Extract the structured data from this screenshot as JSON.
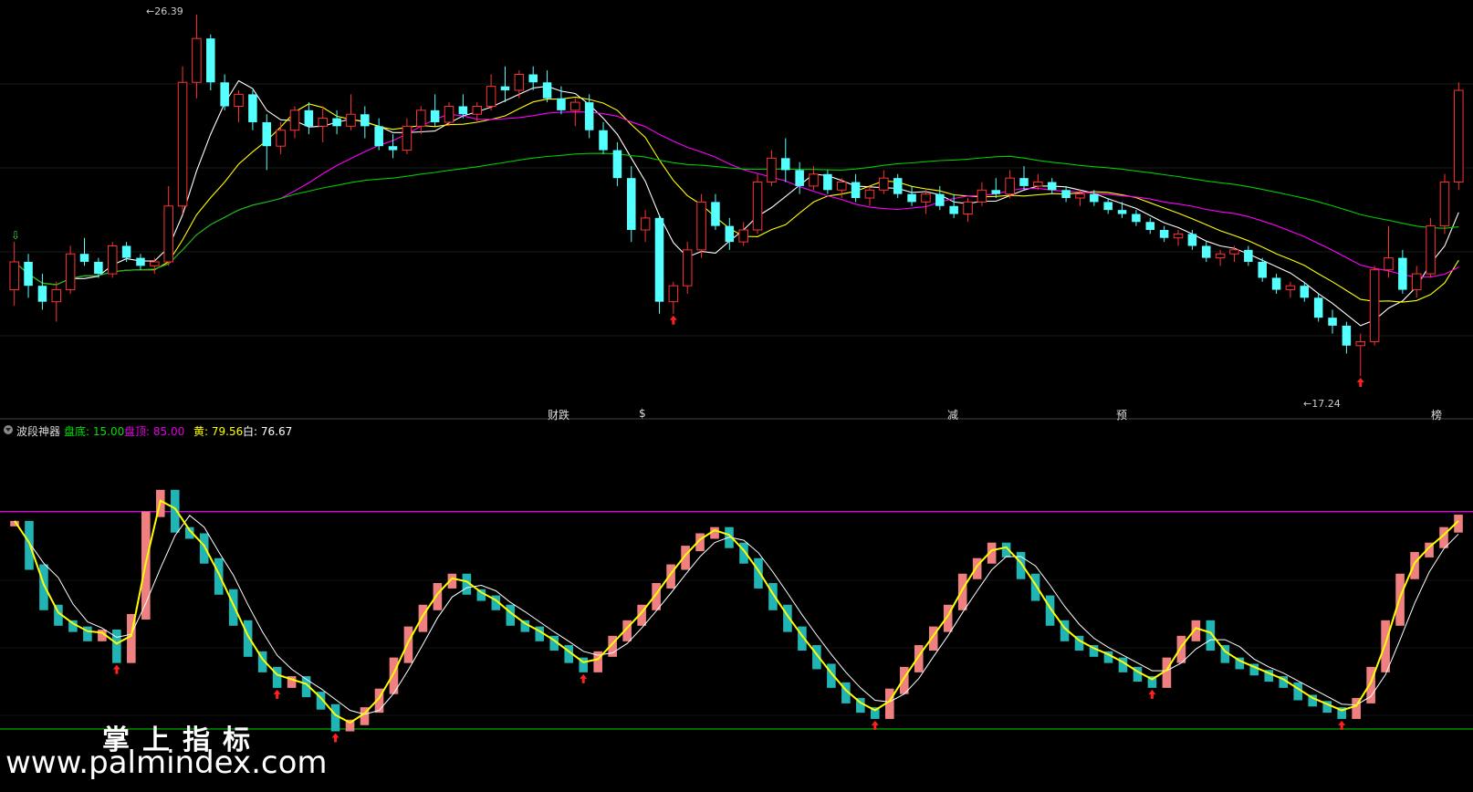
{
  "top_bar": {
    "left_text": "",
    "dots_color": "#c040c0"
  },
  "price_panel": {
    "high_label": "26.39",
    "low_label": "17.24",
    "buy_signal_top": "⇩",
    "signals": [
      {
        "text": "财跌",
        "color": "#9090ff"
      },
      {
        "text": "$",
        "color": "#ff3030"
      },
      {
        "text": "减",
        "color": "#40e040"
      },
      {
        "text": "预",
        "color": "#ff8040"
      },
      {
        "text": "榜",
        "color": "#ff8040"
      }
    ]
  },
  "indicator_panel": {
    "name": "波段神器",
    "items": [
      {
        "label": "盘底: 15.00",
        "color": "#00e000"
      },
      {
        "label": "盘顶: 85.00",
        "color": "#e000e0"
      },
      {
        "label": "黄: 79.56",
        "color": "#ffff00"
      },
      {
        "label": "白: 76.67",
        "color": "#ffffff"
      }
    ]
  },
  "watermark": {
    "line1": "掌上指标",
    "line2": "www.palmindex.com"
  },
  "colors": {
    "up": "#ff3232",
    "down": "#54ffff",
    "osc_up": "#f08080",
    "osc_down": "#20b4b4",
    "ma5": "#ffffff",
    "ma10": "#ffff00",
    "ma20": "#ff00ff",
    "ma60": "#00cc00"
  },
  "chart_data": {
    "type": "candlestick",
    "price_ylim": [
      17.24,
      26.39
    ],
    "candles": [
      [
        19.4,
        20.6,
        19.0,
        20.1
      ],
      [
        20.1,
        20.3,
        19.2,
        19.5
      ],
      [
        19.5,
        19.8,
        18.9,
        19.1
      ],
      [
        19.1,
        19.6,
        18.6,
        19.4
      ],
      [
        19.4,
        20.5,
        19.3,
        20.3
      ],
      [
        20.3,
        20.7,
        20.0,
        20.1
      ],
      [
        20.1,
        20.2,
        19.7,
        19.8
      ],
      [
        19.8,
        20.6,
        19.7,
        20.5
      ],
      [
        20.5,
        20.6,
        20.1,
        20.2
      ],
      [
        20.2,
        20.3,
        19.9,
        20.0
      ],
      [
        20.0,
        20.2,
        19.8,
        20.1
      ],
      [
        20.1,
        22.0,
        20.0,
        21.5
      ],
      [
        21.5,
        25.0,
        21.3,
        24.6
      ],
      [
        24.6,
        26.3,
        24.2,
        25.7
      ],
      [
        25.7,
        25.8,
        24.4,
        24.6
      ],
      [
        24.6,
        24.8,
        23.9,
        24.0
      ],
      [
        24.0,
        24.4,
        23.6,
        24.3
      ],
      [
        24.3,
        24.4,
        23.4,
        23.6
      ],
      [
        23.6,
        23.8,
        22.4,
        23.0
      ],
      [
        23.0,
        23.6,
        22.8,
        23.4
      ],
      [
        23.4,
        24.0,
        23.2,
        23.9
      ],
      [
        23.9,
        24.1,
        23.3,
        23.5
      ],
      [
        23.5,
        24.0,
        23.1,
        23.7
      ],
      [
        23.7,
        23.9,
        23.3,
        23.5
      ],
      [
        23.5,
        24.3,
        23.4,
        23.8
      ],
      [
        23.8,
        24.0,
        23.2,
        23.5
      ],
      [
        23.5,
        23.7,
        22.9,
        23.0
      ],
      [
        23.0,
        23.3,
        22.7,
        22.9
      ],
      [
        22.9,
        23.7,
        22.8,
        23.5
      ],
      [
        23.5,
        24.0,
        23.3,
        23.9
      ],
      [
        23.9,
        24.3,
        23.5,
        23.6
      ],
      [
        23.6,
        24.1,
        23.5,
        24.0
      ],
      [
        24.0,
        24.3,
        23.7,
        23.8
      ],
      [
        23.8,
        24.1,
        23.6,
        24.0
      ],
      [
        24.0,
        24.8,
        23.9,
        24.5
      ],
      [
        24.5,
        25.0,
        24.1,
        24.4
      ],
      [
        24.4,
        24.9,
        24.2,
        24.8
      ],
      [
        24.8,
        25.0,
        24.4,
        24.6
      ],
      [
        24.6,
        24.9,
        24.1,
        24.2
      ],
      [
        24.2,
        24.5,
        23.8,
        23.9
      ],
      [
        23.9,
        24.2,
        23.5,
        24.1
      ],
      [
        24.1,
        24.3,
        23.2,
        23.4
      ],
      [
        23.4,
        23.6,
        22.8,
        22.9
      ],
      [
        22.9,
        23.1,
        22.0,
        22.2
      ],
      [
        22.2,
        22.5,
        20.6,
        20.9
      ],
      [
        20.9,
        21.4,
        20.6,
        21.2
      ],
      [
        21.2,
        21.3,
        18.8,
        19.1
      ],
      [
        19.1,
        19.6,
        18.8,
        19.5
      ],
      [
        19.5,
        20.6,
        19.3,
        20.4
      ],
      [
        20.4,
        21.8,
        20.2,
        21.6
      ],
      [
        21.6,
        21.8,
        20.9,
        21.0
      ],
      [
        21.0,
        21.2,
        20.4,
        20.6
      ],
      [
        20.6,
        21.1,
        20.5,
        20.9
      ],
      [
        20.9,
        22.3,
        20.8,
        22.1
      ],
      [
        22.1,
        22.9,
        22.0,
        22.7
      ],
      [
        22.7,
        23.2,
        22.1,
        22.4
      ],
      [
        22.4,
        22.6,
        21.8,
        22.0
      ],
      [
        22.0,
        22.5,
        21.9,
        22.3
      ],
      [
        22.3,
        22.4,
        21.8,
        21.9
      ],
      [
        21.9,
        22.2,
        21.7,
        22.1
      ],
      [
        22.1,
        22.3,
        21.6,
        21.7
      ],
      [
        21.7,
        22.0,
        21.5,
        21.9
      ],
      [
        21.9,
        22.4,
        21.8,
        22.2
      ],
      [
        22.2,
        22.3,
        21.7,
        21.8
      ],
      [
        21.8,
        22.0,
        21.5,
        21.6
      ],
      [
        21.6,
        21.9,
        21.3,
        21.8
      ],
      [
        21.8,
        22.0,
        21.4,
        21.5
      ],
      [
        21.5,
        21.8,
        21.2,
        21.3
      ],
      [
        21.3,
        21.7,
        21.1,
        21.6
      ],
      [
        21.6,
        22.1,
        21.5,
        21.9
      ],
      [
        21.9,
        22.2,
        21.7,
        21.8
      ],
      [
        21.8,
        22.4,
        21.7,
        22.2
      ],
      [
        22.2,
        22.5,
        21.9,
        22.0
      ],
      [
        22.0,
        22.3,
        21.9,
        22.1
      ],
      [
        22.1,
        22.2,
        21.8,
        21.9
      ],
      [
        21.9,
        22.0,
        21.6,
        21.7
      ],
      [
        21.7,
        21.9,
        21.5,
        21.8
      ],
      [
        21.8,
        21.9,
        21.5,
        21.6
      ],
      [
        21.6,
        21.7,
        21.3,
        21.4
      ],
      [
        21.4,
        21.6,
        21.2,
        21.3
      ],
      [
        21.3,
        21.4,
        21.0,
        21.1
      ],
      [
        21.1,
        21.2,
        20.8,
        20.9
      ],
      [
        20.9,
        21.0,
        20.6,
        20.7
      ],
      [
        20.7,
        20.9,
        20.5,
        20.8
      ],
      [
        20.8,
        20.9,
        20.4,
        20.5
      ],
      [
        20.5,
        20.6,
        20.1,
        20.2
      ],
      [
        20.2,
        20.4,
        20.0,
        20.3
      ],
      [
        20.3,
        20.5,
        20.1,
        20.4
      ],
      [
        20.4,
        20.5,
        20.0,
        20.1
      ],
      [
        20.1,
        20.2,
        19.6,
        19.7
      ],
      [
        19.7,
        19.8,
        19.3,
        19.4
      ],
      [
        19.4,
        19.6,
        19.2,
        19.5
      ],
      [
        19.5,
        19.6,
        19.1,
        19.2
      ],
      [
        19.2,
        19.3,
        18.6,
        18.7
      ],
      [
        18.7,
        18.9,
        18.3,
        18.5
      ],
      [
        18.5,
        18.6,
        17.8,
        18.0
      ],
      [
        18.0,
        18.3,
        17.24,
        18.1
      ],
      [
        18.1,
        20.0,
        18.0,
        19.9
      ],
      [
        19.9,
        21.0,
        19.7,
        20.2
      ],
      [
        20.2,
        20.4,
        19.3,
        19.4
      ],
      [
        19.4,
        20.0,
        19.2,
        19.8
      ],
      [
        19.8,
        21.2,
        19.7,
        21.0
      ],
      [
        21.0,
        22.3,
        20.8,
        22.1
      ],
      [
        22.1,
        24.6,
        21.9,
        24.4
      ]
    ],
    "oscillator": {
      "bottom_line": 15.0,
      "top_line": 85.0,
      "yellow_last": 79.56,
      "white_last": 76.67,
      "bars": [
        82,
        68,
        55,
        50,
        48,
        45,
        47,
        38,
        52,
        85,
        92,
        80,
        78,
        70,
        60,
        50,
        40,
        35,
        30,
        32,
        27,
        23,
        16,
        18,
        22,
        28,
        38,
        48,
        55,
        62,
        65,
        60,
        58,
        55,
        50,
        48,
        45,
        42,
        38,
        35,
        40,
        45,
        50,
        55,
        62,
        68,
        74,
        78,
        80,
        75,
        70,
        62,
        55,
        48,
        42,
        36,
        30,
        25,
        22,
        20,
        28,
        35,
        42,
        48,
        55,
        65,
        70,
        75,
        72,
        65,
        58,
        50,
        45,
        42,
        40,
        38,
        35,
        32,
        30,
        38,
        45,
        50,
        42,
        38,
        36,
        34,
        32,
        30,
        26,
        24,
        22,
        20,
        25,
        35,
        50,
        65,
        72,
        75,
        80,
        84
      ]
    }
  }
}
